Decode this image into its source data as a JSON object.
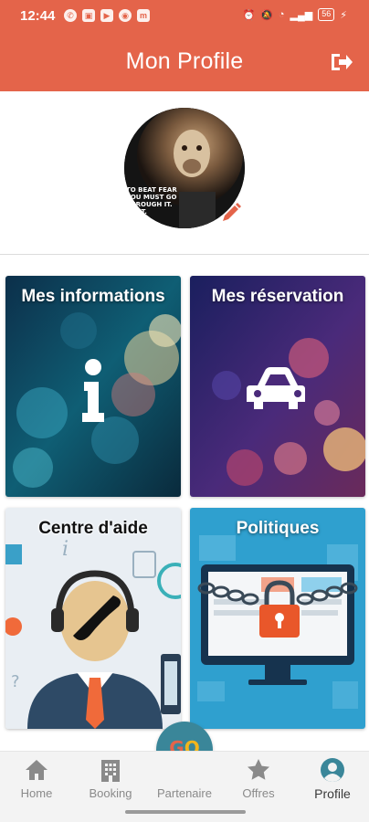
{
  "status_bar": {
    "time": "12:44",
    "battery": "56",
    "icons": [
      "whatsapp-icon",
      "app-icon",
      "youtube-icon",
      "app-icon",
      "m-icon",
      "alarm-icon",
      "mute-icon",
      "wifi-icon",
      "signal-icon"
    ]
  },
  "header": {
    "title": "Mon Profile",
    "logout_icon": "logout-icon"
  },
  "profile": {
    "avatar_caption_lines": [
      "TO BEAT FEAR",
      "YOU MUST GO",
      "THROUGH IT.",
      "UH IT."
    ],
    "edit_icon": "pencil-icon"
  },
  "tiles": [
    {
      "label": "Mes informations",
      "icon": "info-icon"
    },
    {
      "label": "Mes réservation",
      "icon": "car-icon"
    },
    {
      "label": "Centre d'aide",
      "icon": "support-agent-icon"
    },
    {
      "label": "Politiques",
      "icon": "padlock-icon"
    }
  ],
  "bottom_nav": {
    "items": [
      {
        "label": "Home",
        "icon": "home-icon"
      },
      {
        "label": "Booking",
        "icon": "building-icon"
      },
      {
        "label": "Partenaire",
        "icon": "go-logo"
      },
      {
        "label": "Offres",
        "icon": "star-icon"
      },
      {
        "label": "Profile",
        "icon": "person-icon"
      }
    ],
    "active": "Profile",
    "go_logo_g": "G",
    "go_logo_o": "O"
  },
  "colors": {
    "primary": "#e4644a",
    "nav_accent": "#3a8699",
    "active_nav": "#3a3a3a"
  }
}
